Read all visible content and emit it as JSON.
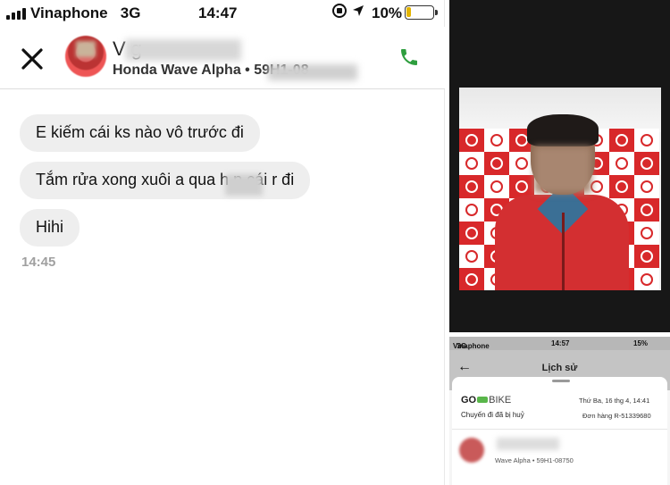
{
  "chat": {
    "status": {
      "carrier": "Vinaphone",
      "network": "3G",
      "time": "14:47",
      "battery": "10%"
    },
    "header": {
      "contact_name": "V              g",
      "vehicle": "Honda Wave Alpha  •  59H1-08"
    },
    "messages": [
      "E kiếm cái ks nào vô trước đi",
      "Tắm rửa xong xuôi a qua h    p cái r đi",
      "Hihi"
    ],
    "timestamp": "14:45"
  },
  "photo": {
    "banner_brand": "goviet"
  },
  "app": {
    "status": {
      "carrier": "Vinaphone",
      "network": "3G",
      "time": "14:57",
      "battery": "15%"
    },
    "title": "Lịch sử",
    "back": "←",
    "card": {
      "brand_go": "GO",
      "brand_bike": "BIKE",
      "status": "Chuyến đi đã bị huỷ",
      "date": "Thứ Ba, 16 thg 4, 14:41",
      "order": "Đơn hàng R-51339680",
      "vehicle": "Wave Alpha  •  59H1-08750"
    }
  },
  "colors": {
    "brand_red": "#d8282a",
    "call_green": "#2e9e3e",
    "bubble_gray": "#eeeeee"
  },
  "icons": [
    "signal-icon",
    "location-icon",
    "rotation-lock-icon",
    "battery-icon",
    "close-icon",
    "phone-icon",
    "back-arrow-icon"
  ]
}
